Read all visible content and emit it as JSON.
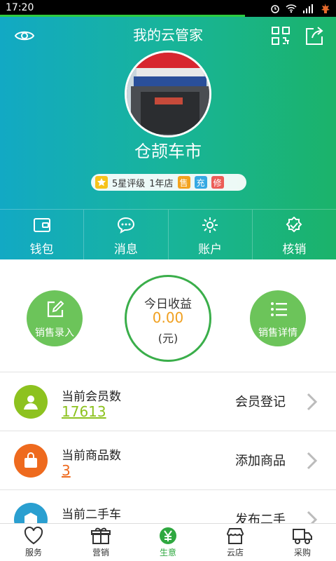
{
  "status_bar": {
    "time": "17:20"
  },
  "header": {
    "title": "我的云管家",
    "store_name": "仓颉车市",
    "rating": {
      "stars_text": "5星评级",
      "years_text": "1年店",
      "tags": [
        "售",
        "充",
        "修"
      ]
    }
  },
  "quick_actions": [
    {
      "label": "钱包",
      "icon": "wallet-icon"
    },
    {
      "label": "消息",
      "icon": "message-icon"
    },
    {
      "label": "账户",
      "icon": "gear-icon"
    },
    {
      "label": "核销",
      "icon": "verify-icon"
    }
  ],
  "income": {
    "title": "今日收益",
    "amount": "0.00",
    "unit": "(元)"
  },
  "sales_entry": {
    "label": "销售录入"
  },
  "sales_detail": {
    "label": "销售详情"
  },
  "rows": [
    {
      "label": "当前会员数",
      "value": "17613",
      "action": "会员登记",
      "color": "#8dc21f"
    },
    {
      "label": "当前商品数",
      "value": "3",
      "action": "添加商品",
      "color": "#ee6a1e"
    },
    {
      "label": "当前二手车",
      "value": "",
      "action": "发布二手",
      "color": "#2a9fd0"
    }
  ],
  "bottom_nav": [
    {
      "label": "服务",
      "icon": "heart-icon"
    },
    {
      "label": "营销",
      "icon": "gift-icon"
    },
    {
      "label": "生意",
      "icon": "yen-icon",
      "active": true
    },
    {
      "label": "云店",
      "icon": "store-icon"
    },
    {
      "label": "采购",
      "icon": "truck-icon"
    }
  ],
  "colors": {
    "header_start": "#12a9c4",
    "header_end": "#1bb36a",
    "accent_green": "#2fa840",
    "income_amount": "#f0a020"
  }
}
